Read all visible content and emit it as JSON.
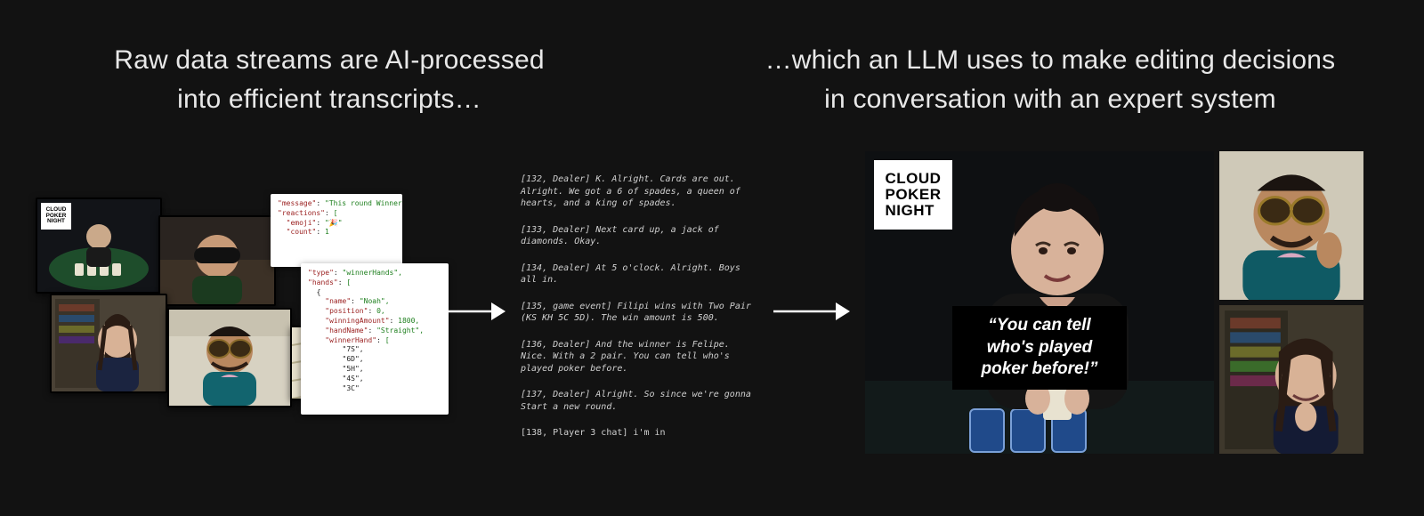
{
  "headings": {
    "left": "Raw data streams are AI-processed\ninto efficient transcripts…",
    "right": "…which an LLM uses to make editing decisions\nin conversation with an expert system"
  },
  "logo_text": "CLOUD\nPOKER\nNIGHT",
  "json_card_1": {
    "lines": [
      {
        "k": "message",
        "v": "\"This round Winner\""
      },
      {
        "k": "reactions",
        "v": "["
      },
      {
        "k": "  emoji",
        "v": "\"🎉\""
      },
      {
        "k": "  count",
        "v": "1"
      }
    ]
  },
  "json_card_2": {
    "lines": [
      {
        "k": "type",
        "v": "\"winnerHands\","
      },
      {
        "k": "hands",
        "v": "["
      },
      {
        "raw": "  {"
      },
      {
        "k": "    name",
        "v": "\"Noah\","
      },
      {
        "k": "    position",
        "v": "0,"
      },
      {
        "k": "    winningAmount",
        "v": "1800,"
      },
      {
        "k": "    handName",
        "v": "\"Straight\","
      },
      {
        "k": "    winnerHand",
        "v": "["
      },
      {
        "raw": "        \"7S\","
      },
      {
        "raw": "        \"6D\","
      },
      {
        "raw": "        \"5H\","
      },
      {
        "raw": "        \"4S\","
      },
      {
        "raw": "        \"3C\""
      }
    ]
  },
  "transcript": [
    {
      "t": "[132, Dealer] K. Alright. Cards are out. Alright. We got a 6 of spades, a queen of hearts, and a king of spades.",
      "i": true
    },
    {
      "t": "[133, Dealer] Next card up, a jack of diamonds. Okay.",
      "i": true
    },
    {
      "t": "[134, Dealer] At 5 o'clock. Alright. Boys all in.",
      "i": true
    },
    {
      "t": "[135, game event] Filipi wins with Two Pair (KS KH 5C 5D). The win amount is 500.",
      "i": true
    },
    {
      "t": "[136, Dealer] And the winner is Felipe. Nice. With a 2 pair. You can tell who's played poker before.",
      "i": true
    },
    {
      "t": "[137, Dealer] Alright. So since we're gonna Start a new round.",
      "i": true
    },
    {
      "t": "[138, Player 3 chat] i'm in",
      "i": false
    }
  ],
  "caption": "“You can tell who's played poker before!”"
}
